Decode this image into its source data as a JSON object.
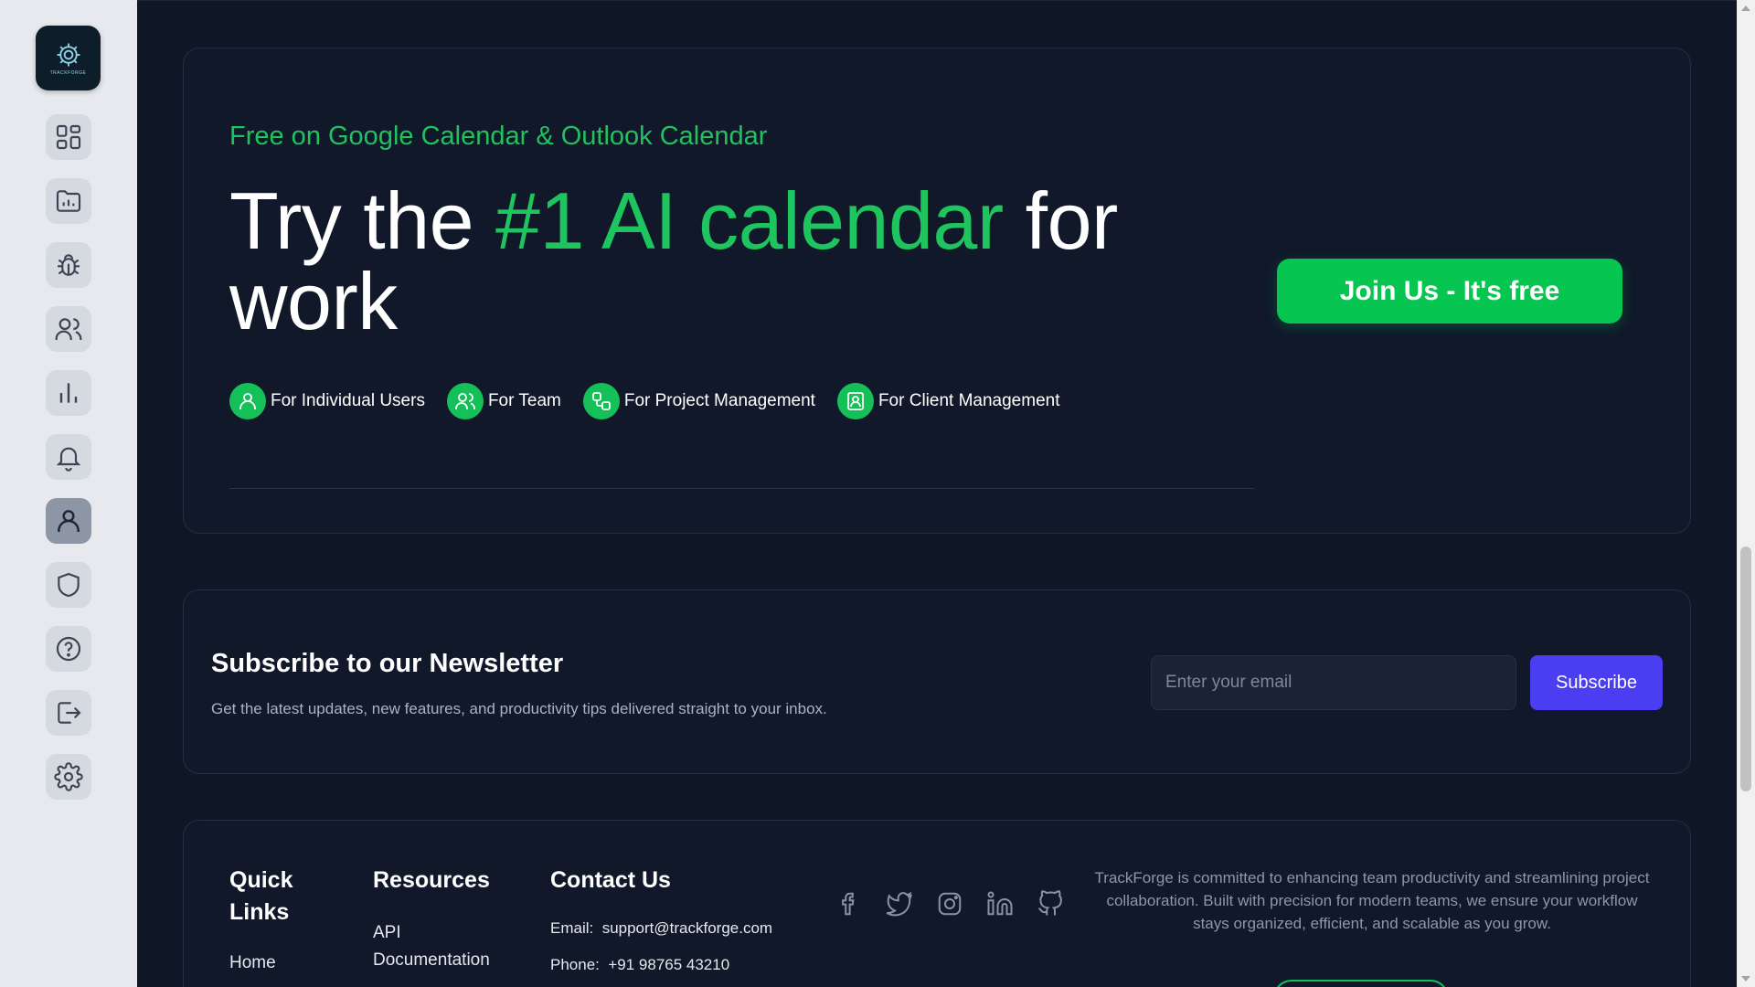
{
  "sidebar": {
    "logo_text": "TRACKFORGE",
    "items": [
      {
        "name": "dashboard",
        "icon": "grid-icon"
      },
      {
        "name": "projects",
        "icon": "folder-chart-icon"
      },
      {
        "name": "bugs",
        "icon": "bug-icon"
      },
      {
        "name": "team",
        "icon": "users-icon"
      },
      {
        "name": "reports",
        "icon": "bar-chart-icon"
      },
      {
        "name": "notifications",
        "icon": "bell-icon"
      },
      {
        "name": "profile",
        "icon": "user-icon",
        "active": true
      },
      {
        "name": "security",
        "icon": "shield-icon"
      },
      {
        "name": "help",
        "icon": "question-icon"
      },
      {
        "name": "logout",
        "icon": "logout-icon"
      },
      {
        "name": "settings",
        "icon": "gear-icon"
      }
    ]
  },
  "cta": {
    "subtitle": "Free on Google Calendar & Outlook Calendar",
    "title_pre": "Try the ",
    "title_highlight": "#1 AI calendar",
    "title_post": " for work",
    "join_label": "Join Us - It's free",
    "pills": [
      {
        "label": "For Individual Users",
        "icon": "user-icon"
      },
      {
        "label": "For Team",
        "icon": "users-icon"
      },
      {
        "label": "For Project Management",
        "icon": "project-icon"
      },
      {
        "label": "For Client Management",
        "icon": "contact-icon"
      }
    ]
  },
  "newsletter": {
    "title": "Subscribe to our Newsletter",
    "description": "Get the latest updates, new features, and productivity tips delivered straight to your inbox.",
    "email_placeholder": "Enter your email",
    "email_value": "",
    "subscribe_label": "Subscribe"
  },
  "footer": {
    "quick_links_heading": "Quick Links",
    "quick_links": [
      "Home"
    ],
    "resources_heading": "Resources",
    "resources": [
      "API Documentation"
    ],
    "contact_heading": "Contact Us",
    "email_label": "Email:",
    "email": "support@trackforge.com",
    "phone_label": "Phone:",
    "phone": "+91 98765 43210",
    "socials": [
      "facebook-icon",
      "twitter-icon",
      "instagram-icon",
      "linkedin-icon",
      "github-icon"
    ],
    "about": "TrackForge is committed to enhancing team productivity and streamlining project collaboration. Built with precision for modern teams, we ensure your workflow stays organized, efficient, and scalable as you grow."
  },
  "colors": {
    "accent_green": "#1ec55e",
    "subscribe_purple": "#4b3ef2",
    "background": "#0f1626",
    "sidebar": "#e7e9ee"
  }
}
